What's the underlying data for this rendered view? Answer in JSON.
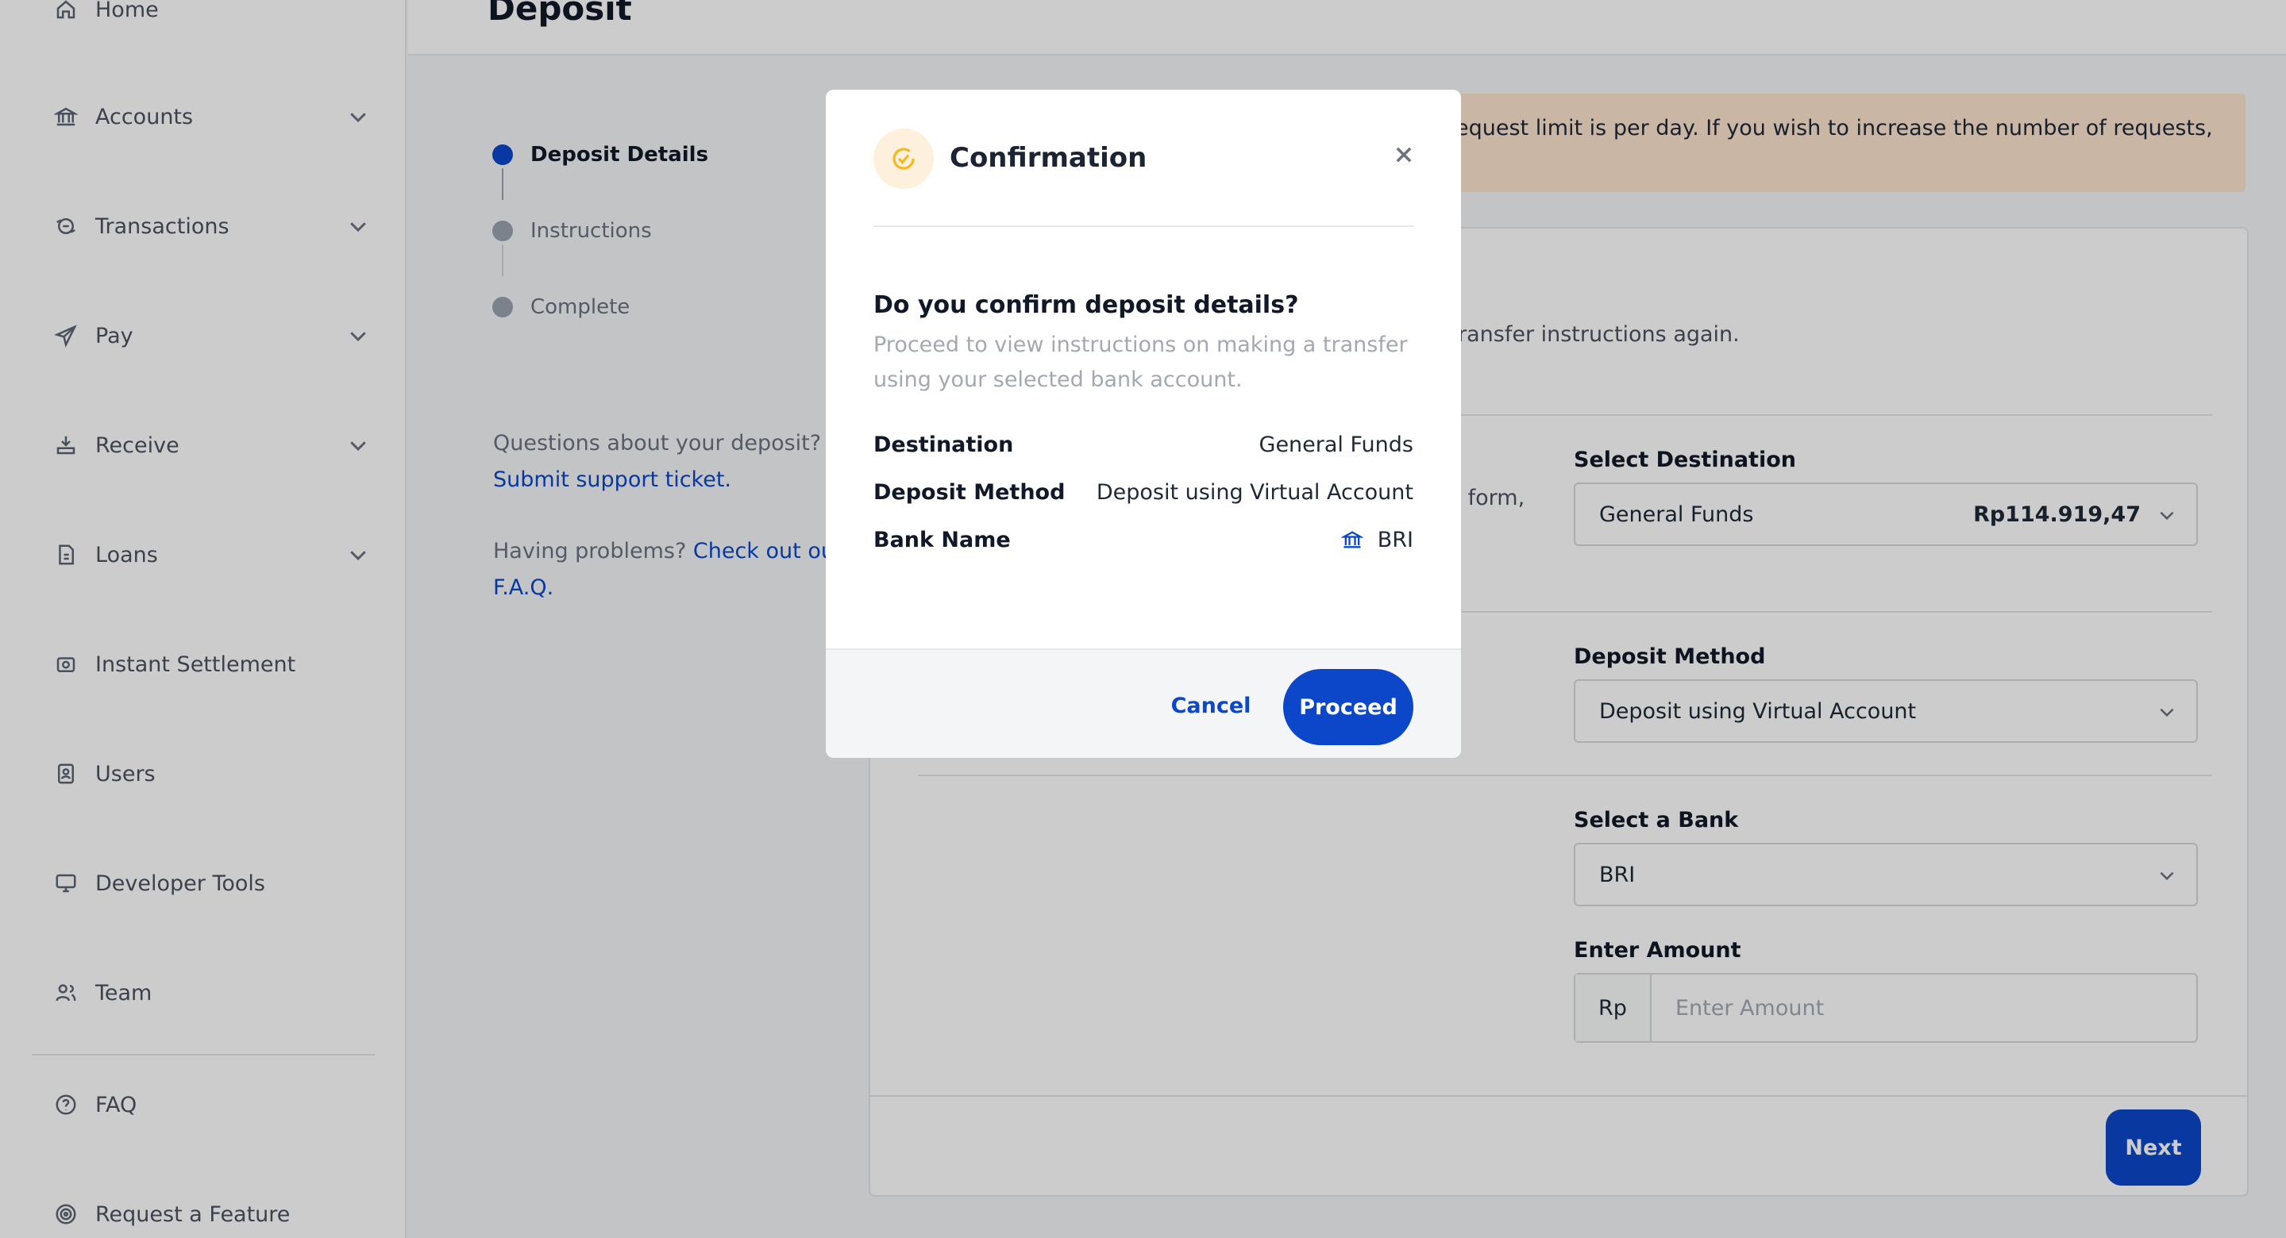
{
  "sidebar": {
    "items": [
      {
        "label": "Home",
        "icon": "home-icon",
        "has_chevron": false
      },
      {
        "label": "Accounts",
        "icon": "bank-icon",
        "has_chevron": true
      },
      {
        "label": "Transactions",
        "icon": "transactions-icon",
        "has_chevron": true
      },
      {
        "label": "Pay",
        "icon": "send-icon",
        "has_chevron": true
      },
      {
        "label": "Receive",
        "icon": "receive-icon",
        "has_chevron": true
      },
      {
        "label": "Loans",
        "icon": "loans-icon",
        "has_chevron": true
      },
      {
        "label": "Instant Settlement",
        "icon": "settlement-icon",
        "has_chevron": false
      },
      {
        "label": "Users",
        "icon": "users-icon",
        "has_chevron": false
      },
      {
        "label": "Developer Tools",
        "icon": "monitor-icon",
        "has_chevron": false
      },
      {
        "label": "Team",
        "icon": "team-icon",
        "has_chevron": false
      },
      {
        "label": "FAQ",
        "icon": "help-icon",
        "has_chevron": false
      },
      {
        "label": "Request a Feature",
        "icon": "target-icon",
        "has_chevron": false
      }
    ]
  },
  "header": {
    "title": "Deposit"
  },
  "stepper": {
    "steps": [
      {
        "label": "Deposit Details",
        "active": true
      },
      {
        "label": "Instructions",
        "active": false
      },
      {
        "label": "Complete",
        "active": false
      }
    ]
  },
  "help": {
    "question": "Questions about your deposit?",
    "support_link": "Submit support ticket.",
    "problems": "Having problems?",
    "faq_link_line1": "Check out our",
    "faq_link_line2": "F.A.Q."
  },
  "alert": {
    "text": "equest limit is per day. If you wish to increase the number of requests,"
  },
  "form": {
    "subtitle": "ransfer instructions again.",
    "side_note": "s form,",
    "destination": {
      "label": "Select Destination",
      "value": "General Funds",
      "balance": "Rp114.919,47"
    },
    "method": {
      "label": "Deposit Method",
      "value": "Deposit using Virtual Account"
    },
    "bank": {
      "label": "Select a Bank",
      "value": "BRI"
    },
    "amount": {
      "label": "Enter Amount",
      "prefix": "Rp",
      "placeholder": "Enter Amount"
    },
    "next_label": "Next"
  },
  "modal": {
    "title": "Confirmation",
    "question": "Do you confirm deposit details?",
    "description": "Proceed to view instructions on making a transfer using your selected bank account.",
    "rows": [
      {
        "key": "Destination",
        "value": "General Funds"
      },
      {
        "key": "Deposit Method",
        "value": "Deposit using Virtual Account"
      },
      {
        "key": "Bank Name",
        "value": "BRI"
      }
    ],
    "cancel_label": "Cancel",
    "proceed_label": "Proceed"
  },
  "colors": {
    "primary": "#0b47c8",
    "alert_bg": "#fde4cf",
    "confirm_icon": "#f5b924"
  }
}
